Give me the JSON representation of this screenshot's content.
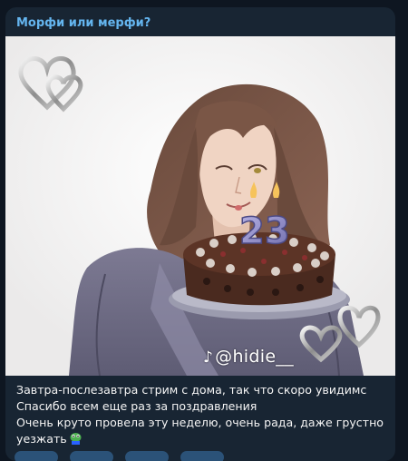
{
  "post": {
    "channel_title": "Морфи или мерфи?",
    "watermark": {
      "icon": "tiktok-icon",
      "handle": "@hidie__"
    },
    "cake_number": "23",
    "caption_lines": [
      "Завтра-послезавтра стрим с дома, так что скоро увидимс",
      "Спасибо всем еще раз за поздравления",
      "Очень круто провела эту неделю, очень рада, даже грустно",
      "уезжать"
    ],
    "sticker_icon": "pepe-frog-icon"
  },
  "colors": {
    "background": "#0e1621",
    "bubble": "#182533",
    "author_name": "#64b5ef",
    "text": "#f5f5f5"
  }
}
